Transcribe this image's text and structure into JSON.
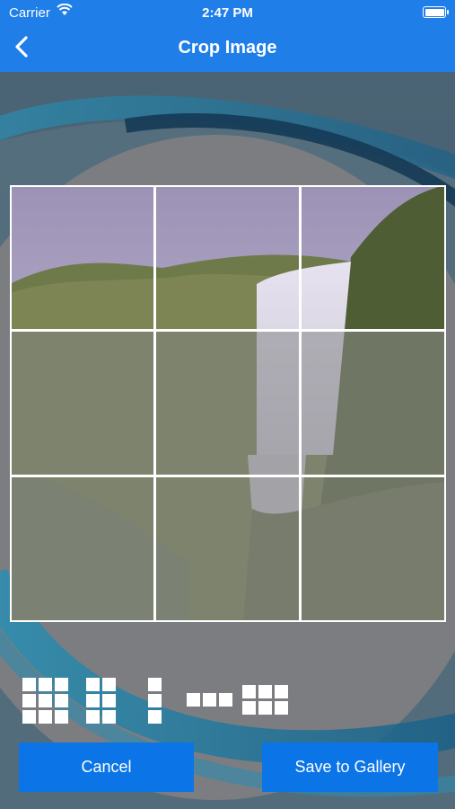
{
  "status": {
    "carrier": "Carrier",
    "time": "2:47 PM"
  },
  "nav": {
    "title": "Crop Image",
    "back_icon": "chevron-left-icon"
  },
  "crop": {
    "grid_rows": 3,
    "grid_cols": 3
  },
  "tools": [
    {
      "name": "grid-3x3-icon",
      "rows": 3,
      "cols": 3
    },
    {
      "name": "grid-3x2-icon",
      "rows": 3,
      "cols": 2
    },
    {
      "name": "grid-3x1-icon",
      "rows": 3,
      "cols": 1
    },
    {
      "name": "grid-1x3-icon",
      "rows": 1,
      "cols": 3
    },
    {
      "name": "grid-2x3-icon",
      "rows": 2,
      "cols": 3
    }
  ],
  "buttons": {
    "cancel": "Cancel",
    "save": "Save to Gallery"
  },
  "colors": {
    "nav_blue": "#1f7ee8",
    "button_blue": "#0b74e6"
  }
}
